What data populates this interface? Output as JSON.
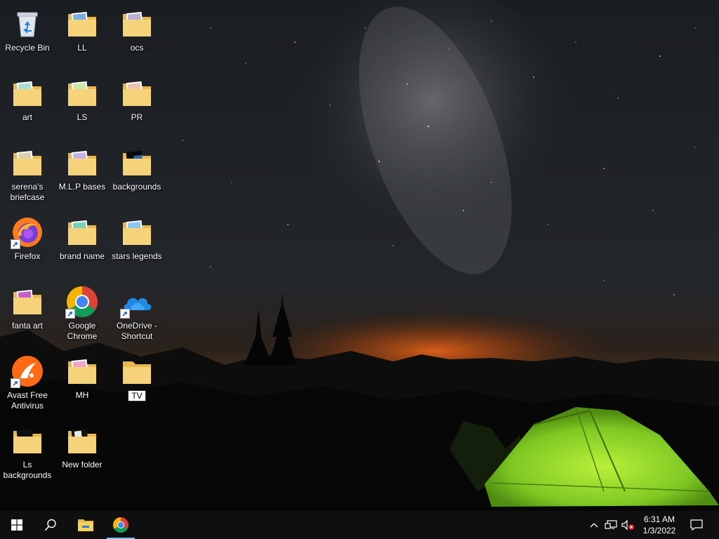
{
  "desktop": {
    "icons": [
      {
        "label": "Recycle Bin",
        "icon": "recycle-bin-icon"
      },
      {
        "label": "LL",
        "icon": "folder-icon"
      },
      {
        "label": "ocs",
        "icon": "folder-icon"
      },
      {
        "label": "art",
        "icon": "folder-icon"
      },
      {
        "label": "LS",
        "icon": "folder-icon"
      },
      {
        "label": "PR",
        "icon": "folder-icon"
      },
      {
        "label": "serena's briefcase",
        "icon": "folder-icon"
      },
      {
        "label": "M.L.P bases",
        "icon": "folder-icon"
      },
      {
        "label": "backgrounds",
        "icon": "folder-icon"
      },
      {
        "label": "Firefox",
        "icon": "firefox-icon"
      },
      {
        "label": "brand name",
        "icon": "folder-icon"
      },
      {
        "label": "stars legends",
        "icon": "folder-icon"
      },
      {
        "label": "fanta art",
        "icon": "folder-icon"
      },
      {
        "label": "Google Chrome",
        "icon": "chrome-icon"
      },
      {
        "label": "OneDrive - Shortcut",
        "icon": "onedrive-icon"
      },
      {
        "label": "Avast Free Antivirus",
        "icon": "avast-icon"
      },
      {
        "label": "MH",
        "icon": "folder-icon"
      },
      {
        "label": "TV",
        "icon": "folder-icon"
      },
      {
        "label": "Ls backgrounds",
        "icon": "folder-icon"
      },
      {
        "label": "New folder",
        "icon": "folder-icon"
      }
    ]
  },
  "taskbar": {
    "start": "windows-logo-icon",
    "search": "search-icon",
    "pinned": [
      "file-explorer-icon",
      "chrome-icon"
    ],
    "tray": [
      "chevron-up-icon",
      "network-icon",
      "volume-muted-icon"
    ],
    "clock": {
      "time": "6:31 AM",
      "date": "1/3/2022"
    },
    "notifications": "notification-icon"
  },
  "colors": {
    "taskbar_bg": "#0f0f10",
    "active_indicator": "#76b9ed",
    "tent": "#8fdc2c"
  }
}
